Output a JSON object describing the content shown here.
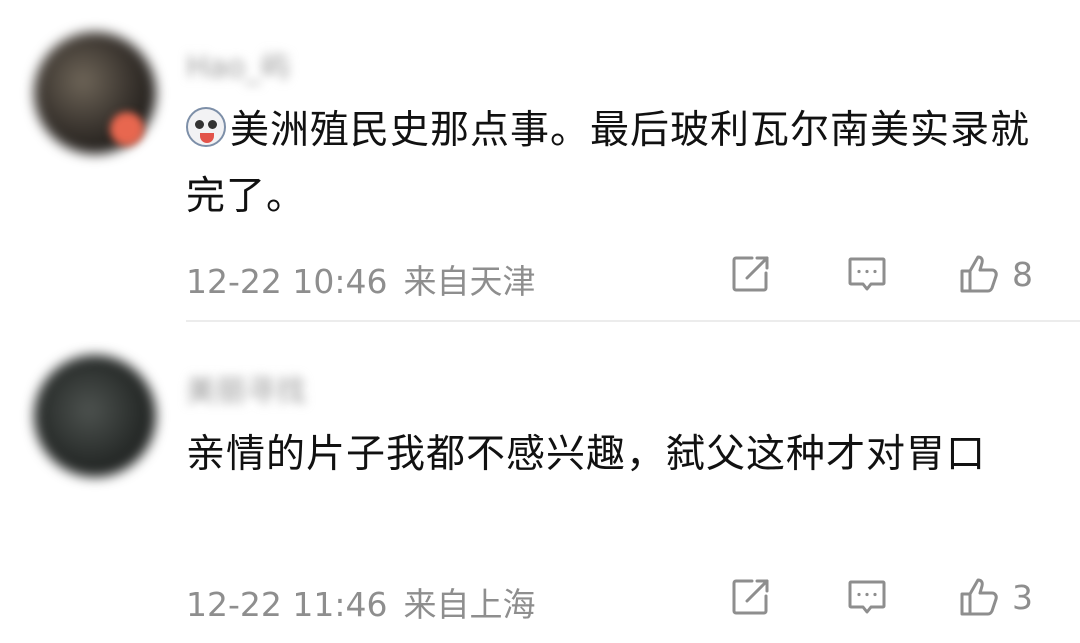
{
  "comments": [
    {
      "username": "Hao_屿",
      "emoji_icon": "husky-face-emoji",
      "text": "美洲殖民史那点事。最后玻利瓦尔南美实录就完了。",
      "time": "12-22 10:46",
      "location": "来自天津",
      "likes": "8"
    },
    {
      "username": "美丽寻找",
      "text": "亲情的片子我都不感兴趣，弑父这种才对胃口",
      "time": "12-22 11:46",
      "location": "来自上海",
      "likes": "3"
    }
  ],
  "icons": {
    "share": "share-icon",
    "comment": "comment-icon",
    "like": "thumbs-up-icon"
  },
  "colors": {
    "text": "#111111",
    "meta": "#8e8e8e",
    "badge": "#e8674f"
  }
}
